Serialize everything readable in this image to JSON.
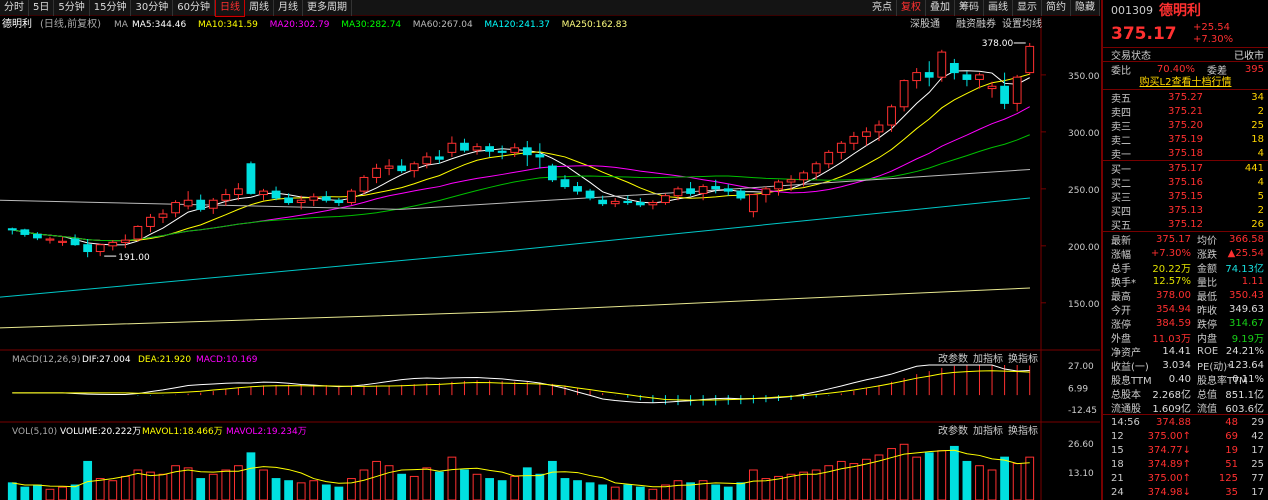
{
  "toolbar": {
    "items": [
      "分时",
      "5日",
      "5分钟",
      "15分钟",
      "30分钟",
      "60分钟",
      "日线",
      "周线",
      "月线",
      "更多周期"
    ],
    "active": "日线",
    "right": [
      "亮点",
      "复权",
      "叠加",
      "筹码",
      "画线",
      "显示",
      "简约",
      "隐藏"
    ]
  },
  "legend": {
    "name": "德明利",
    "mode": "(日线,前复权)",
    "ma": [
      {
        "t": "MA5:344.46",
        "c": "#ffffff"
      },
      {
        "t": "MA10:341.59",
        "c": "#ffff00"
      },
      {
        "t": "MA20:302.79",
        "c": "#ff00ff"
      },
      {
        "t": "MA30:282.74",
        "c": "#00ff00"
      },
      {
        "t": "MA60:267.04",
        "c": "#bbbbbb"
      },
      {
        "t": "MA120:241.37",
        "c": "#00ffff"
      },
      {
        "t": "MA250:162.83",
        "c": "#ffff80"
      }
    ],
    "right": [
      "深股通",
      "融资融券",
      "设置均线"
    ]
  },
  "price_axis": [
    "350.00",
    "300.00",
    "250.00",
    "200.00",
    "150.00"
  ],
  "annotations": {
    "high": "378.00",
    "low": "191.00"
  },
  "macd": {
    "title": "MACD(12,26,9)",
    "dif": "DIF:27.004",
    "dea": "DEA:21.920",
    "macd": "MACD:10.169",
    "btns": [
      "改参数",
      "加指标",
      "换指标"
    ],
    "axis": [
      "27.00",
      "6.99",
      "-12.45"
    ]
  },
  "vol": {
    "title": "VOL(5,10)",
    "volume": "VOLUME:20.222万",
    "mavol1": "MAVOL1:18.466万",
    "mavol2": "MAVOL2:19.234万",
    "btns": [
      "改参数",
      "加指标",
      "换指标"
    ],
    "axis": [
      "26.60",
      "13.10"
    ]
  },
  "quote": {
    "code": "001309",
    "name": "德明利",
    "price": "375.17",
    "change": "+25.54",
    "pct": "+7.30%",
    "status_lbl": "交易状态",
    "status": "已收市",
    "wb_lbl": "委比",
    "wb": "70.40%",
    "wc_lbl": "委差",
    "wc": "395",
    "l2": "购买L2查看十档行情",
    "sells": [
      {
        "l": "卖五",
        "p": "375.27",
        "q": "34"
      },
      {
        "l": "卖四",
        "p": "375.21",
        "q": "2"
      },
      {
        "l": "卖三",
        "p": "375.20",
        "q": "25"
      },
      {
        "l": "卖二",
        "p": "375.19",
        "q": "18"
      },
      {
        "l": "卖一",
        "p": "375.18",
        "q": "4"
      }
    ],
    "buys": [
      {
        "l": "买一",
        "p": "375.17",
        "q": "441"
      },
      {
        "l": "买二",
        "p": "375.16",
        "q": "4"
      },
      {
        "l": "买三",
        "p": "375.15",
        "q": "5"
      },
      {
        "l": "买四",
        "p": "375.13",
        "q": "2"
      },
      {
        "l": "买五",
        "p": "375.12",
        "q": "26"
      }
    ],
    "stats": [
      {
        "l1": "最新",
        "v1": "375.17",
        "c1": "r",
        "l2": "均价",
        "v2": "366.58",
        "c2": "r"
      },
      {
        "l1": "涨幅",
        "v1": "+7.30%",
        "c1": "r",
        "l2": "涨跌",
        "v2": "▲25.54",
        "c2": "r"
      },
      {
        "l1": "总手",
        "v1": "20.22万",
        "c1": "y",
        "l2": "金额",
        "v2": "74.13亿",
        "c2": "c"
      },
      {
        "l1": "换手*",
        "v1": "12.57%",
        "c1": "y",
        "l2": "量比",
        "v2": "1.11",
        "c2": "r"
      },
      {
        "l1": "最高",
        "v1": "378.00",
        "c1": "r",
        "l2": "最低",
        "v2": "350.43",
        "c2": "r"
      },
      {
        "l1": "今开",
        "v1": "354.94",
        "c1": "r",
        "l2": "昨收",
        "v2": "349.63",
        "c2": "w"
      },
      {
        "l1": "涨停",
        "v1": "384.59",
        "c1": "r",
        "l2": "跌停",
        "v2": "314.67",
        "c2": "g"
      },
      {
        "l1": "外盘",
        "v1": "11.03万",
        "c1": "r",
        "l2": "内盘",
        "v2": "9.19万",
        "c2": "g"
      },
      {
        "l1": "净资产",
        "v1": "14.41",
        "c1": "w",
        "l2": "ROE",
        "v2": "24.21%",
        "c2": "w"
      },
      {
        "l1": "收益(一)",
        "v1": "3.034",
        "c1": "w",
        "l2": "PE(动)*",
        "v2": "123.64",
        "c2": "w"
      },
      {
        "l1": "股息TTM",
        "v1": "0.40",
        "c1": "w",
        "l2": "股息率TTM",
        "v2": "0.11%",
        "c2": "w"
      },
      {
        "l1": "总股本",
        "v1": "2.268亿",
        "c1": "w",
        "l2": "总值",
        "v2": "851.1亿",
        "c2": "w"
      },
      {
        "l1": "流通股",
        "v1": "1.609亿",
        "c1": "w",
        "l2": "流值",
        "v2": "603.6亿",
        "c2": "w"
      }
    ],
    "ticks": [
      {
        "t": "14:56",
        "p": "374.88",
        "a": "",
        "q": "48",
        "n": "29"
      },
      {
        "t": "12",
        "p": "375.00",
        "a": "↑",
        "q": "69",
        "n": "42"
      },
      {
        "t": "15",
        "p": "374.77",
        "a": "↓",
        "q": "19",
        "n": "17"
      },
      {
        "t": "18",
        "p": "374.89",
        "a": "↑",
        "q": "51",
        "n": "25"
      },
      {
        "t": "21",
        "p": "375.00",
        "a": "↑",
        "q": "125",
        "n": "77"
      },
      {
        "t": "24",
        "p": "374.98",
        "a": "↓",
        "q": "35",
        "n": "17"
      }
    ]
  },
  "chart_data": {
    "type": "candlestick",
    "ylim": [
      120,
      385
    ],
    "candles": [
      [
        215,
        216,
        210,
        214
      ],
      [
        214,
        215,
        208,
        210
      ],
      [
        210,
        212,
        205,
        207
      ],
      [
        205,
        208,
        202,
        206
      ],
      [
        203,
        208,
        200,
        204
      ],
      [
        206,
        210,
        200,
        201
      ],
      [
        201,
        206,
        190,
        195
      ],
      [
        195,
        202,
        191,
        201
      ],
      [
        200,
        205,
        196,
        203
      ],
      [
        203,
        210,
        198,
        205
      ],
      [
        206,
        218,
        204,
        217
      ],
      [
        217,
        228,
        212,
        225
      ],
      [
        225,
        232,
        220,
        228
      ],
      [
        229,
        240,
        225,
        238
      ],
      [
        235,
        248,
        232,
        240
      ],
      [
        240,
        245,
        230,
        232
      ],
      [
        233,
        242,
        228,
        240
      ],
      [
        240,
        250,
        235,
        245
      ],
      [
        245,
        255,
        240,
        250
      ],
      [
        272,
        274,
        245,
        246
      ],
      [
        245,
        250,
        240,
        248
      ],
      [
        248,
        252,
        240,
        242
      ],
      [
        242,
        246,
        236,
        238
      ],
      [
        238,
        244,
        232,
        240
      ],
      [
        240,
        246,
        235,
        243
      ],
      [
        243,
        248,
        238,
        240
      ],
      [
        240,
        242,
        235,
        238
      ],
      [
        238,
        250,
        236,
        248
      ],
      [
        248,
        262,
        245,
        260
      ],
      [
        260,
        272,
        255,
        268
      ],
      [
        268,
        276,
        262,
        270
      ],
      [
        270,
        276,
        264,
        266
      ],
      [
        266,
        274,
        260,
        272
      ],
      [
        272,
        282,
        268,
        278
      ],
      [
        278,
        284,
        272,
        276
      ],
      [
        282,
        296,
        278,
        290
      ],
      [
        290,
        294,
        282,
        284
      ],
      [
        284,
        290,
        280,
        287
      ],
      [
        287,
        290,
        278,
        283
      ],
      [
        283,
        288,
        276,
        282
      ],
      [
        282,
        290,
        278,
        286
      ],
      [
        286,
        292,
        270,
        280
      ],
      [
        280,
        290,
        268,
        278
      ],
      [
        270,
        272,
        256,
        258
      ],
      [
        258,
        262,
        250,
        252
      ],
      [
        252,
        256,
        245,
        248
      ],
      [
        248,
        250,
        240,
        242
      ],
      [
        240,
        244,
        235,
        237
      ],
      [
        237,
        242,
        234,
        239
      ],
      [
        239,
        244,
        236,
        238
      ],
      [
        238,
        242,
        234,
        236
      ],
      [
        236,
        240,
        232,
        238
      ],
      [
        238,
        246,
        236,
        244
      ],
      [
        244,
        252,
        240,
        250
      ],
      [
        250,
        256,
        244,
        246
      ],
      [
        246,
        254,
        240,
        252
      ],
      [
        252,
        258,
        246,
        250
      ],
      [
        250,
        254,
        244,
        248
      ],
      [
        248,
        250,
        240,
        242
      ],
      [
        230,
        245,
        225,
        245
      ],
      [
        245,
        252,
        238,
        250
      ],
      [
        250,
        258,
        244,
        256
      ],
      [
        256,
        262,
        248,
        258
      ],
      [
        258,
        266,
        252,
        264
      ],
      [
        264,
        274,
        258,
        272
      ],
      [
        272,
        284,
        268,
        282
      ],
      [
        282,
        292,
        276,
        290
      ],
      [
        290,
        300,
        284,
        296
      ],
      [
        296,
        304,
        288,
        300
      ],
      [
        300,
        310,
        292,
        306
      ],
      [
        306,
        324,
        300,
        322
      ],
      [
        322,
        346,
        318,
        345
      ],
      [
        345,
        356,
        338,
        352
      ],
      [
        352,
        362,
        340,
        348
      ],
      [
        348,
        372,
        344,
        370
      ],
      [
        360,
        364,
        346,
        352
      ],
      [
        350,
        353,
        340,
        346
      ],
      [
        346,
        352,
        338,
        350
      ],
      [
        338,
        344,
        330,
        340
      ],
      [
        340,
        352,
        320,
        325
      ],
      [
        325,
        350,
        318,
        348
      ],
      [
        352,
        378,
        350,
        375
      ]
    ],
    "volume": [
      8,
      6,
      7,
      5,
      6,
      7,
      18,
      10,
      9,
      11,
      14,
      13,
      12,
      16,
      15,
      10,
      12,
      14,
      16,
      22,
      14,
      10,
      9,
      8,
      9,
      7,
      6,
      10,
      14,
      18,
      16,
      12,
      11,
      15,
      13,
      20,
      14,
      12,
      10,
      9,
      11,
      15,
      12,
      18,
      10,
      9,
      8,
      7,
      6,
      7,
      6,
      5,
      7,
      9,
      8,
      9,
      7,
      6,
      8,
      14,
      10,
      11,
      12,
      13,
      14,
      16,
      18,
      17,
      19,
      21,
      24,
      26,
      20,
      22,
      23,
      25,
      18,
      16,
      14,
      20,
      17,
      20
    ]
  }
}
